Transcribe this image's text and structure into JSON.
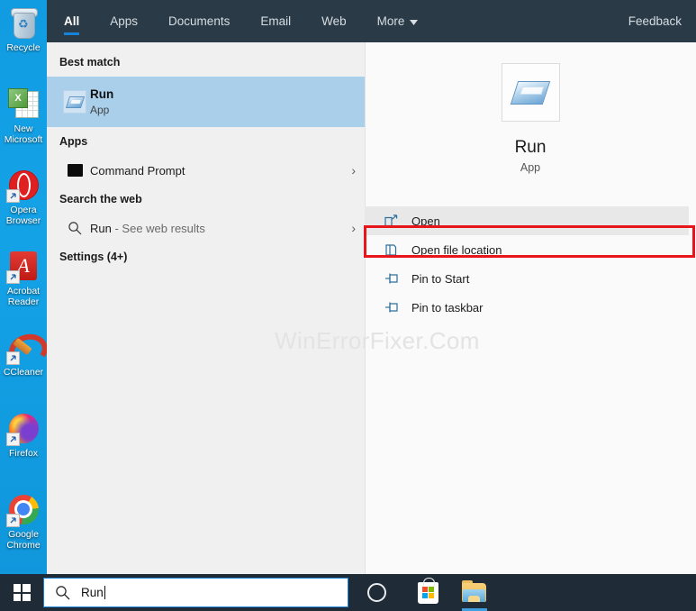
{
  "desktop": {
    "icons": [
      {
        "name": "recycle-bin",
        "label": "Recycle"
      },
      {
        "name": "new-microsoft-excel",
        "label": "New Microsoft"
      },
      {
        "name": "opera-browser",
        "label": "Opera Browser"
      },
      {
        "name": "acrobat-reader",
        "label": "Acrobat Reader"
      },
      {
        "name": "ccleaner",
        "label": "CCleaner"
      },
      {
        "name": "firefox",
        "label": "Firefox"
      },
      {
        "name": "google-chrome",
        "label": "Google Chrome"
      }
    ]
  },
  "flyout": {
    "tabs": [
      {
        "label": "All",
        "active": true
      },
      {
        "label": "Apps",
        "active": false
      },
      {
        "label": "Documents",
        "active": false
      },
      {
        "label": "Email",
        "active": false
      },
      {
        "label": "Web",
        "active": false
      },
      {
        "label": "More",
        "active": false,
        "has_chevron": true
      }
    ],
    "feedback_label": "Feedback",
    "sections": {
      "best_match": {
        "heading": "Best match",
        "item": {
          "title": "Run",
          "subtitle": "App",
          "icon": "run-app-icon",
          "selected": true
        }
      },
      "apps": {
        "heading": "Apps",
        "items": [
          {
            "label": "Command Prompt",
            "icon": "command-prompt-icon",
            "chevron": "›"
          }
        ]
      },
      "search_the_web": {
        "heading": "Search the web",
        "items": [
          {
            "query": "Run",
            "suffix": " - See web results",
            "icon": "search-icon",
            "chevron": "›"
          }
        ]
      },
      "settings": {
        "heading": "Settings (4+)"
      }
    },
    "preview": {
      "icon": "run-app-icon",
      "title": "Run",
      "subtitle": "App",
      "actions": [
        {
          "label": "Open",
          "icon": "open-external-icon",
          "highlighted": true
        },
        {
          "label": "Open file location",
          "icon": "folder-location-icon",
          "highlighted": false
        },
        {
          "label": "Pin to Start",
          "icon": "pin-icon",
          "highlighted": false
        },
        {
          "label": "Pin to taskbar",
          "icon": "pin-icon",
          "highlighted": false
        }
      ]
    },
    "watermark": "WinErrorFixer.Com",
    "highlight_color": "#e8151a",
    "accent_color": "#1683d8"
  },
  "taskbar": {
    "start_label": "Start",
    "search": {
      "value": "Run",
      "icon": "search-icon"
    },
    "items": [
      {
        "name": "cortana-icon",
        "label": "Cortana"
      },
      {
        "name": "microsoft-store-icon",
        "label": "Microsoft Store"
      },
      {
        "name": "file-explorer-icon",
        "label": "File Explorer",
        "active": true
      }
    ]
  }
}
